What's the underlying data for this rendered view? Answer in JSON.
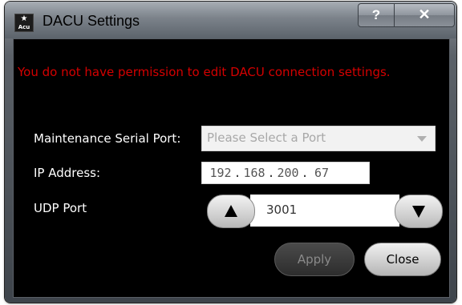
{
  "window": {
    "title": "DACU Settings",
    "app_icon_text": "Acu",
    "help_label": "?",
    "close_label": "✕"
  },
  "message": {
    "permission_error": "You do not have permission to edit DACU connection settings.",
    "color": "#d40000"
  },
  "form": {
    "serial_port": {
      "label": "Maintenance Serial Port:",
      "placeholder": "Please Select a Port"
    },
    "ip_address": {
      "label": "IP Address:",
      "octets": [
        "192",
        "168",
        "200",
        "67"
      ],
      "separator": "."
    },
    "udp_port": {
      "label": "UDP Port",
      "value": "3001"
    }
  },
  "buttons": {
    "apply_label": "Apply",
    "close_label": "Close"
  }
}
